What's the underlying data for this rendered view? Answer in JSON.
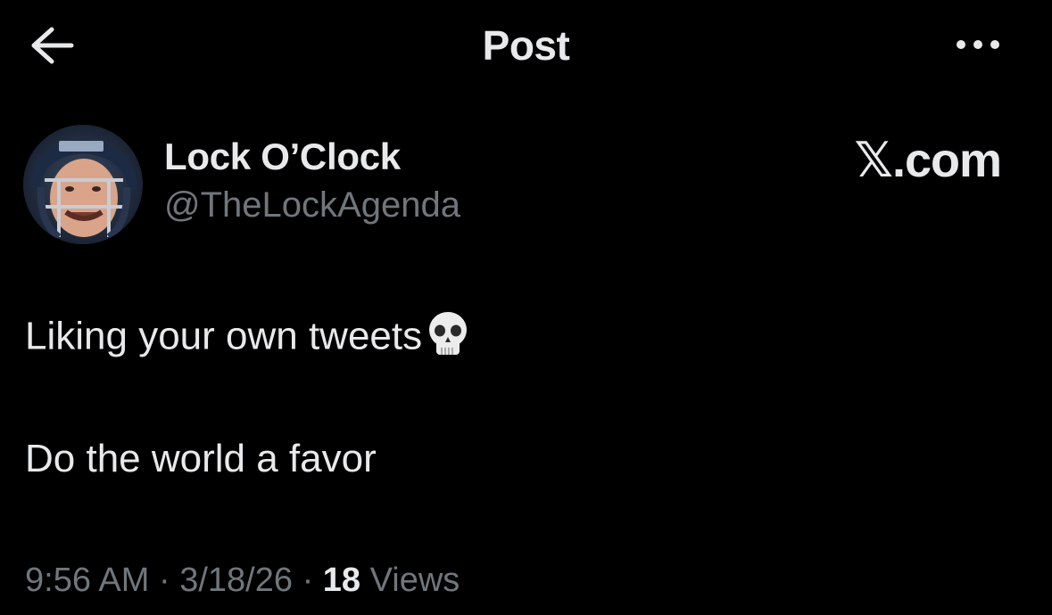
{
  "header": {
    "title": "Post",
    "back_icon": "arrow-left-icon",
    "more_icon": "more-horizontal-icon"
  },
  "author": {
    "display_name": "Lock O’Clock",
    "handle": "@TheLockAgenda",
    "source": "𝕏.com"
  },
  "post": {
    "line1": "Liking your own tweets",
    "line1_emoji": "skull-emoji-icon",
    "line2": "Do the world a favor"
  },
  "meta": {
    "time": "9:56 AM",
    "separator": "·",
    "date": "3/18/26",
    "views_count": "18",
    "views_label": "Views"
  },
  "colors": {
    "background": "#000000",
    "text_primary": "#e7e9ea",
    "text_secondary": "#71767b"
  }
}
